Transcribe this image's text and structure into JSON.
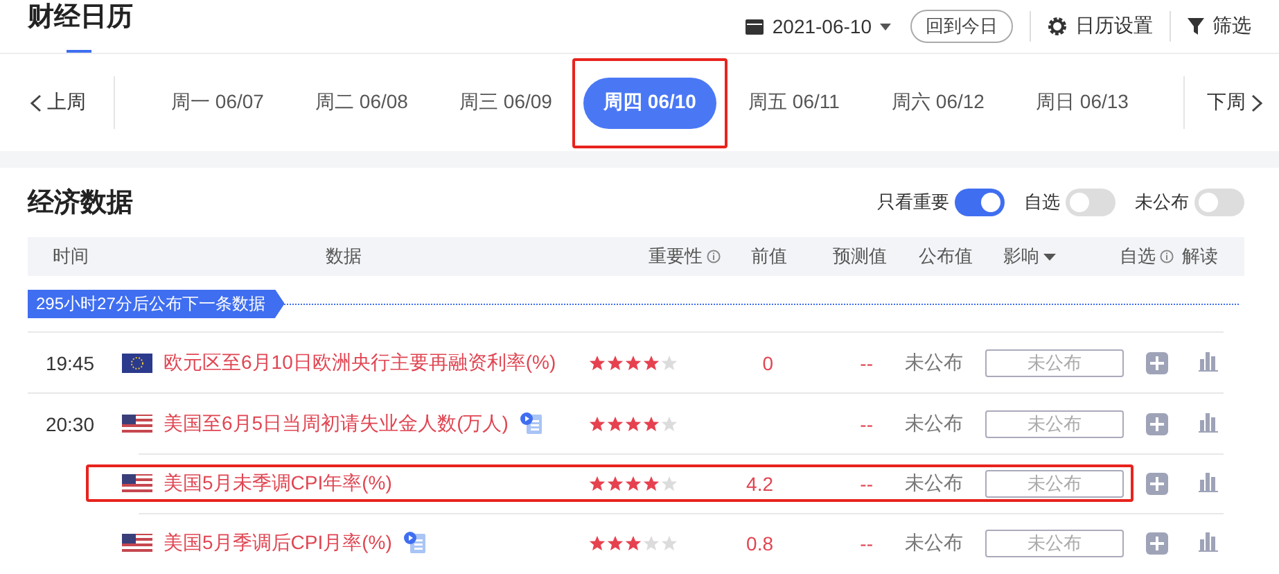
{
  "header": {
    "title": "财经日历",
    "date": "2021-06-10",
    "today_button": "回到今日",
    "settings": "日历设置",
    "filter": "筛选"
  },
  "week_nav": {
    "prev": "上周",
    "next": "下周",
    "days": [
      {
        "label": "周一 06/07",
        "selected": false,
        "highlighted": false
      },
      {
        "label": "周二 06/08",
        "selected": false,
        "highlighted": false
      },
      {
        "label": "周三 06/09",
        "selected": false,
        "highlighted": false
      },
      {
        "label": "周四 06/10",
        "selected": true,
        "highlighted": true
      },
      {
        "label": "周五 06/11",
        "selected": false,
        "highlighted": false
      },
      {
        "label": "周六 06/12",
        "selected": false,
        "highlighted": false
      },
      {
        "label": "周日 06/13",
        "selected": false,
        "highlighted": false
      }
    ]
  },
  "section": {
    "title": "经济数据",
    "toggles": [
      {
        "label": "只看重要",
        "on": true
      },
      {
        "label": "自选",
        "on": false
      },
      {
        "label": "未公布",
        "on": false
      }
    ]
  },
  "table": {
    "columns": [
      "时间",
      "数据",
      "重要性",
      "前值",
      "预测值",
      "公布值",
      "影响",
      "自选",
      "解读"
    ],
    "countdown": "295小时27分后公布下一条数据",
    "rows": [
      {
        "time": "19:45",
        "kind": "eu",
        "name": "欧元区至6月10日欧洲央行主要再融资利率(%)",
        "has_video": false,
        "stars": 4,
        "previous": "0",
        "forecast": "--",
        "actual": "未公布",
        "impact": "未公布",
        "highlighted": false
      },
      {
        "time": "20:30",
        "kind": "us",
        "name": "美国至6月5日当周初请失业金人数(万人)",
        "has_video": true,
        "stars": 4,
        "forecast": "--",
        "actual": "未公布",
        "impact": "未公布",
        "highlighted": false
      },
      {
        "kind": "us",
        "name": "美国5月未季调CPI年率(%)",
        "has_video": false,
        "stars": 4,
        "previous": "4.2",
        "forecast": "--",
        "actual": "未公布",
        "impact": "未公布",
        "highlighted": true
      },
      {
        "kind": "us",
        "name": "美国5月季调后CPI月率(%)",
        "has_video": true,
        "stars": 3,
        "previous": "0.8",
        "forecast": "--",
        "actual": "未公布",
        "impact": "未公布",
        "highlighted": false
      }
    ]
  }
}
